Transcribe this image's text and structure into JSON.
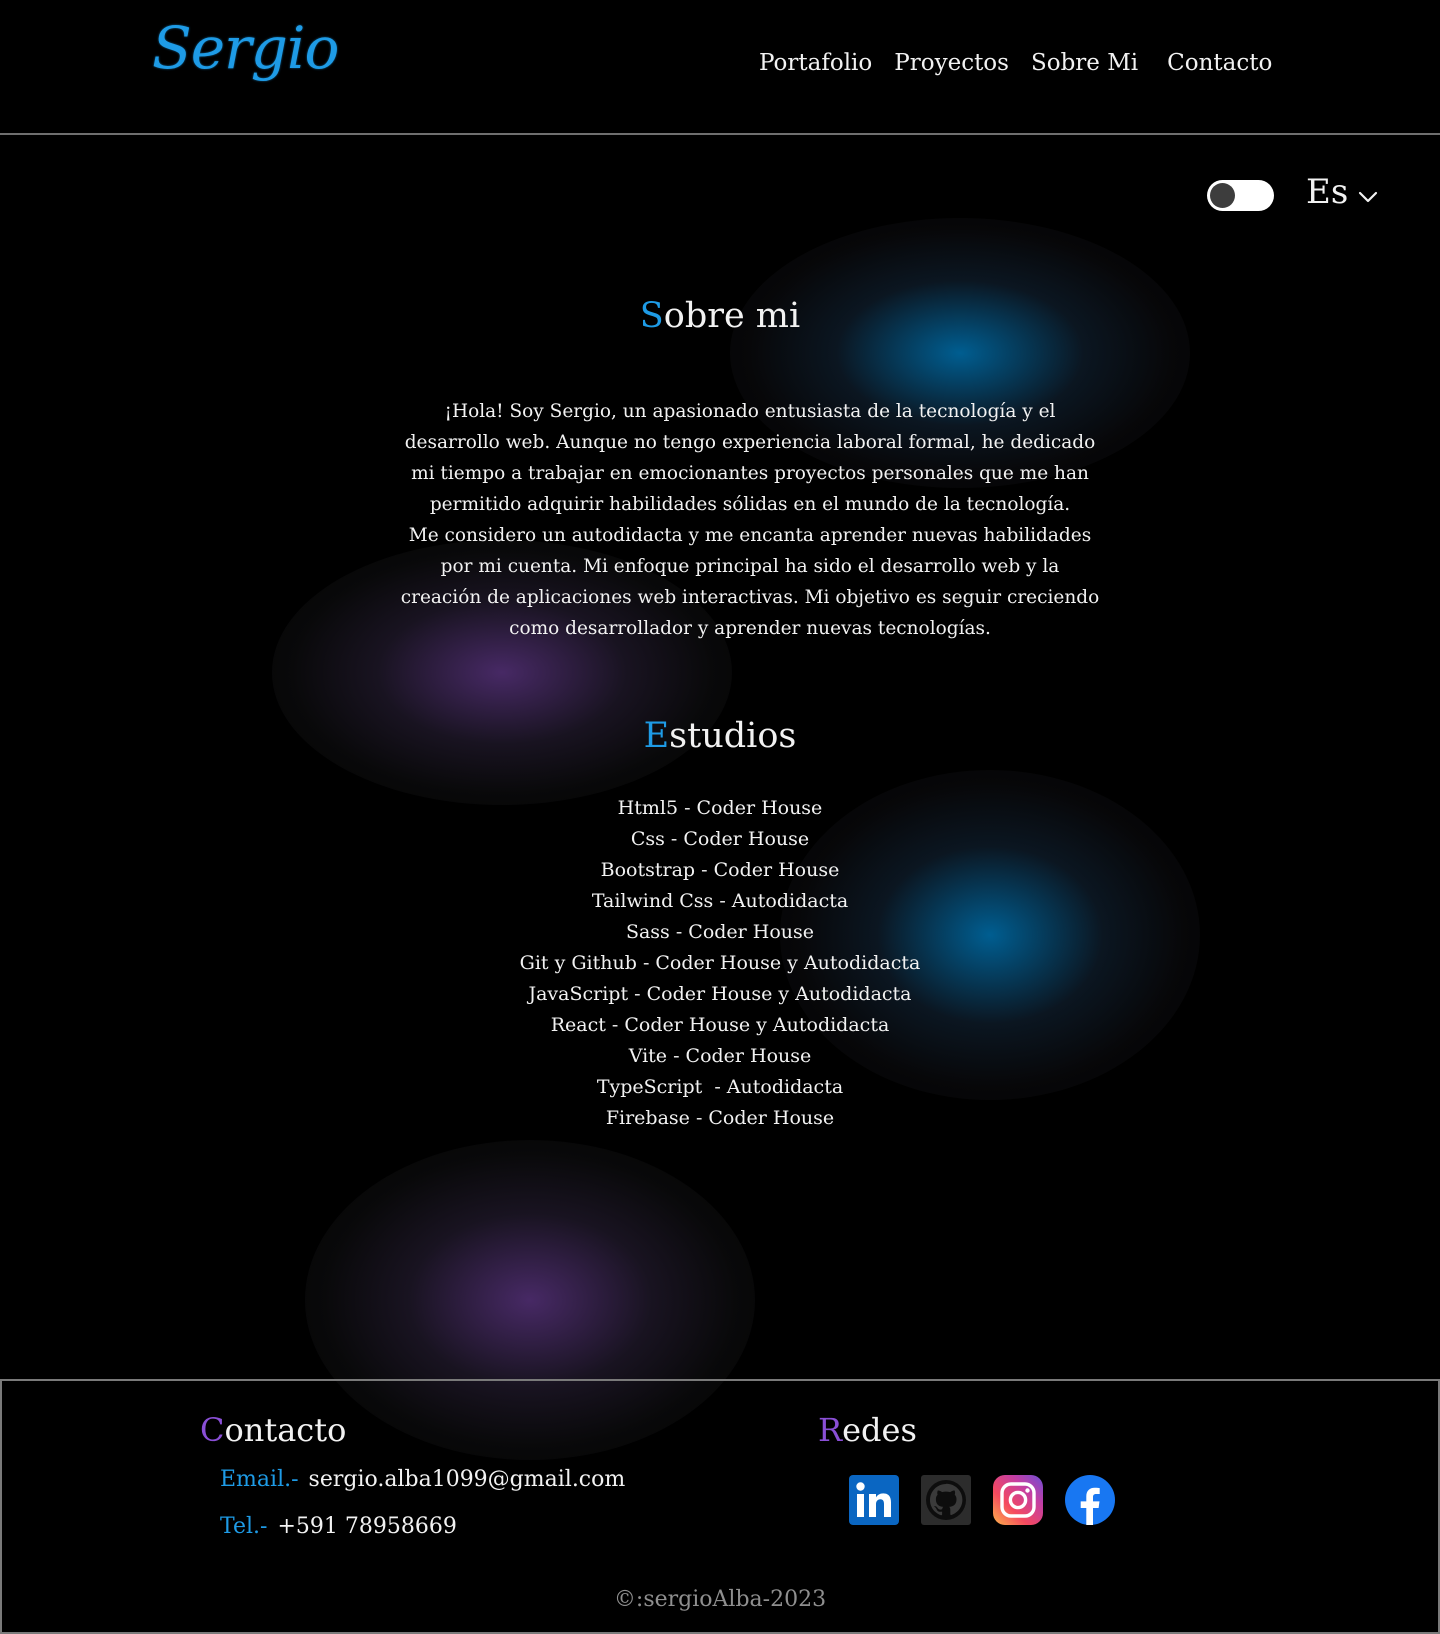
{
  "colors": {
    "accent_blue": "#1e9be6",
    "accent_purple": "#8a4fd6",
    "background": "#000000",
    "text": "#f2f2f2"
  },
  "header": {
    "logo": "Sergio",
    "nav": [
      "Portafolio",
      "Proyectos",
      "Sobre Mi",
      "Contacto"
    ]
  },
  "controls": {
    "theme_toggle_on": false,
    "language": "Es",
    "language_icon": "chevron-down-icon"
  },
  "about": {
    "title_first": "S",
    "title_rest": "obre mi",
    "paragraphs": [
      "¡Hola! Soy Sergio, un apasionado entusiasta de la tecnología y el desarrollo web. Aunque no tengo experiencia laboral formal, he dedicado mi tiempo a trabajar en emocionantes proyectos personales que me han permitido adquirir habilidades sólidas en el mundo de la tecnología.",
      "Me considero un autodidacta y me encanta aprender nuevas habilidades por mi cuenta. Mi enfoque principal ha sido el desarrollo web y la creación de aplicaciones web interactivas. Mi objetivo es seguir creciendo como desarrollador y aprender nuevas tecnologías."
    ]
  },
  "studies": {
    "title_first": "E",
    "title_rest": "studios",
    "items": [
      "Html5 - Coder House",
      "Css - Coder House",
      "Bootstrap - Coder House",
      "Tailwind Css - Autodidacta",
      "Sass - Coder House",
      "Git y Github - Coder House y Autodidacta",
      "JavaScript - Coder House y Autodidacta",
      "React - Coder House y Autodidacta",
      "Vite - Coder House",
      "TypeScript  - Autodidacta",
      "Firebase - Coder House"
    ]
  },
  "footer": {
    "contact_title_first": "C",
    "contact_title_rest": "ontacto",
    "email_label": "Email.-",
    "email_value": "sergio.alba1099@gmail.com",
    "tel_label": "Tel.-",
    "tel_value": "+591 78958669",
    "social_title_first": "R",
    "social_title_rest": "edes",
    "socials": [
      "linkedin-icon",
      "github-icon",
      "instagram-icon",
      "facebook-icon"
    ],
    "copyright": "©:sergioAlba-2023"
  }
}
